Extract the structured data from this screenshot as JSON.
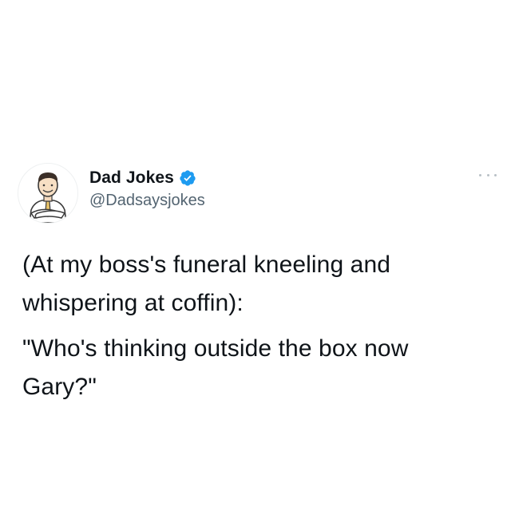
{
  "author": {
    "display_name": "Dad Jokes",
    "handle": "@Dadsaysjokes",
    "verified": true,
    "avatar_icon": "cartoon-man-arms-crossed-avatar"
  },
  "menu_icon": "more-dots-icon",
  "tweet": {
    "lines": [
      "(At my boss's funeral kneeling and",
      "whispering at coffin):",
      "\"Who's thinking outside the box now",
      "Gary?\""
    ]
  },
  "colors": {
    "background": "#ffffff",
    "text": "#0f1419",
    "secondary_text": "#536471",
    "verified_blue": "#1d9bf0"
  }
}
